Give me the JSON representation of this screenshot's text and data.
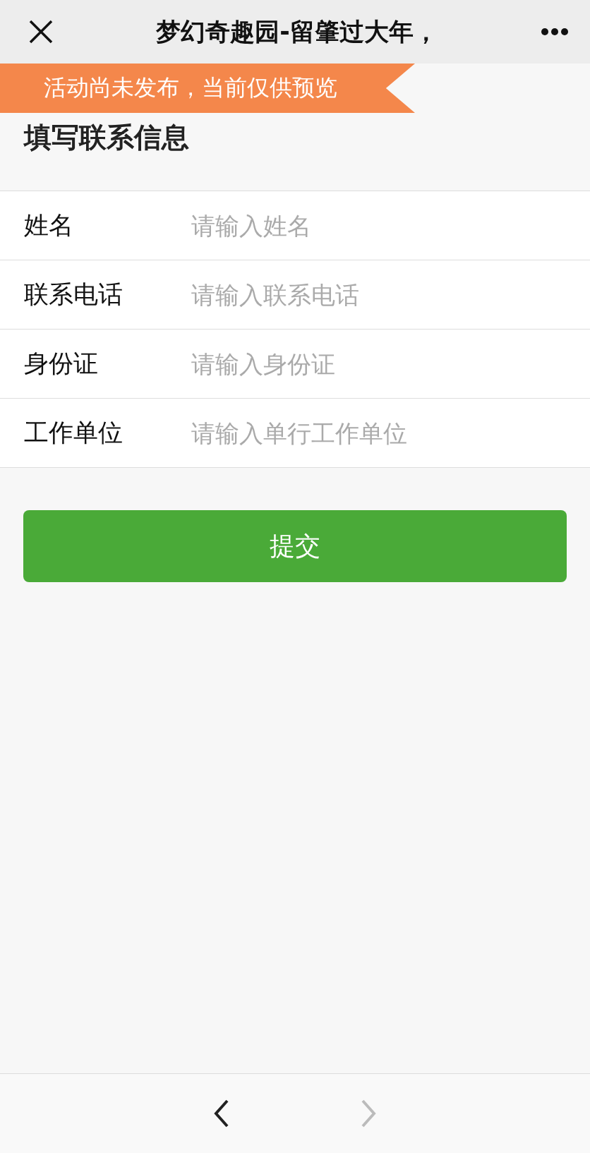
{
  "window": {
    "title": "梦幻奇趣园-留肇过大年，"
  },
  "banner": {
    "text": "活动尚未发布，当前仅供预览"
  },
  "heading": "填写联系信息",
  "fields": [
    {
      "label": "姓名",
      "placeholder": "请输入姓名"
    },
    {
      "label": "联系电话",
      "placeholder": "请输入联系电话"
    },
    {
      "label": "身份证",
      "placeholder": "请输入身份证"
    },
    {
      "label": "工作单位",
      "placeholder": "请输入单行工作单位"
    }
  ],
  "submit": "提交",
  "nav": {
    "back_disabled": false,
    "forward_disabled": true
  }
}
